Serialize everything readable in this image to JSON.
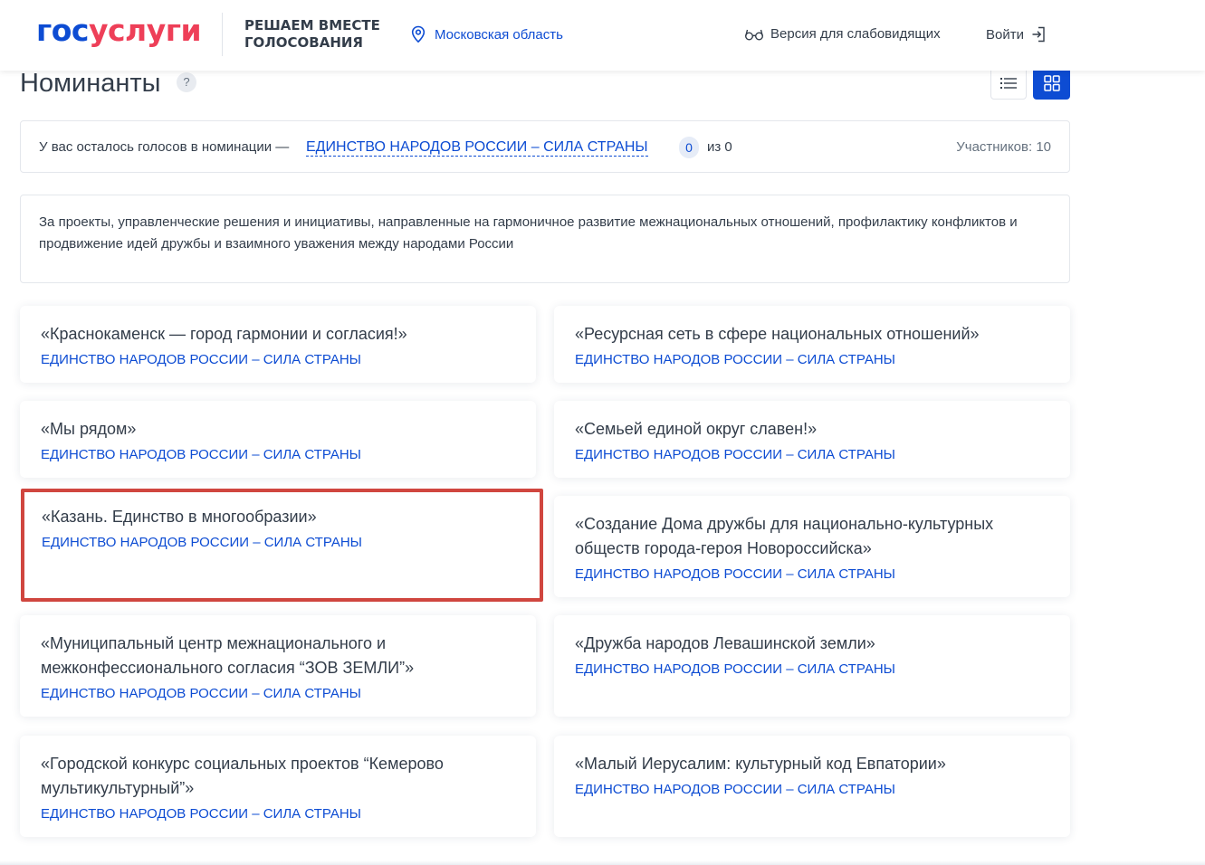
{
  "header": {
    "logo_part1": "гос",
    "logo_part2": "услуги",
    "brand_subtitle": "РЕШАЕМ ВМЕСТЕ ГОЛОСОВАНИЯ",
    "region": "Московская область",
    "vision_mode": "Версия для слабовидящих",
    "login": "Войти"
  },
  "page": {
    "title": "Номинанты",
    "help": "?"
  },
  "votes": {
    "prefix": "У вас осталось голосов в номинации —",
    "nomination_link": "ЕДИНСТВО НАРОДОВ РОССИИ – СИЛА СТРАНЫ",
    "count": "0",
    "of_total": "из 0",
    "participants": "Участников: 10"
  },
  "description": "За проекты, управленческие решения и инициативы, направленные на гармоничное развитие межнациональных отношений, профилактику конфликтов и продвижение идей дружбы и взаимного уважения между народами России",
  "cards": [
    {
      "title": "«Краснокаменск — город гармонии и согласия!»",
      "nomination": "ЕДИНСТВО НАРОДОВ РОССИИ – СИЛА СТРАНЫ"
    },
    {
      "title": "«Ресурсная сеть в сфере национальных отношений»",
      "nomination": "ЕДИНСТВО НАРОДОВ РОССИИ – СИЛА СТРАНЫ"
    },
    {
      "title": "«Мы рядом»",
      "nomination": "ЕДИНСТВО НАРОДОВ РОССИИ – СИЛА СТРАНЫ"
    },
    {
      "title": "«Семьей единой округ славен!»",
      "nomination": "ЕДИНСТВО НАРОДОВ РОССИИ – СИЛА СТРАНЫ"
    },
    {
      "title": "«Казань. Единство в многообразии»",
      "nomination": "ЕДИНСТВО НАРОДОВ РОССИИ – СИЛА СТРАНЫ"
    },
    {
      "title": "«Создание Дома дружбы для национально-культурных обществ города-героя Новороссийска»",
      "nomination": "ЕДИНСТВО НАРОДОВ РОССИИ – СИЛА СТРАНЫ"
    },
    {
      "title": "«Муниципальный центр межнационального и межконфессионального согласия “ЗОВ ЗЕМЛИ”»",
      "nomination": "ЕДИНСТВО НАРОДОВ РОССИИ – СИЛА СТРАНЫ"
    },
    {
      "title": "«Дружба народов Левашинской земли»",
      "nomination": "ЕДИНСТВО НАРОДОВ РОССИИ – СИЛА СТРАНЫ"
    },
    {
      "title": "«Городской конкурс социальных проектов “Кемерово мультикультурный”»",
      "nomination": "ЕДИНСТВО НАРОДОВ РОССИИ – СИЛА СТРАНЫ"
    },
    {
      "title": "«Малый Иерусалим: культурный код Евпатории»",
      "nomination": "ЕДИНСТВО НАРОДОВ РОССИИ – СИЛА СТРАНЫ"
    }
  ],
  "colors": {
    "brand_blue": "#0d4cd3",
    "brand_red": "#ee3f58",
    "highlight": "#d0463f"
  }
}
